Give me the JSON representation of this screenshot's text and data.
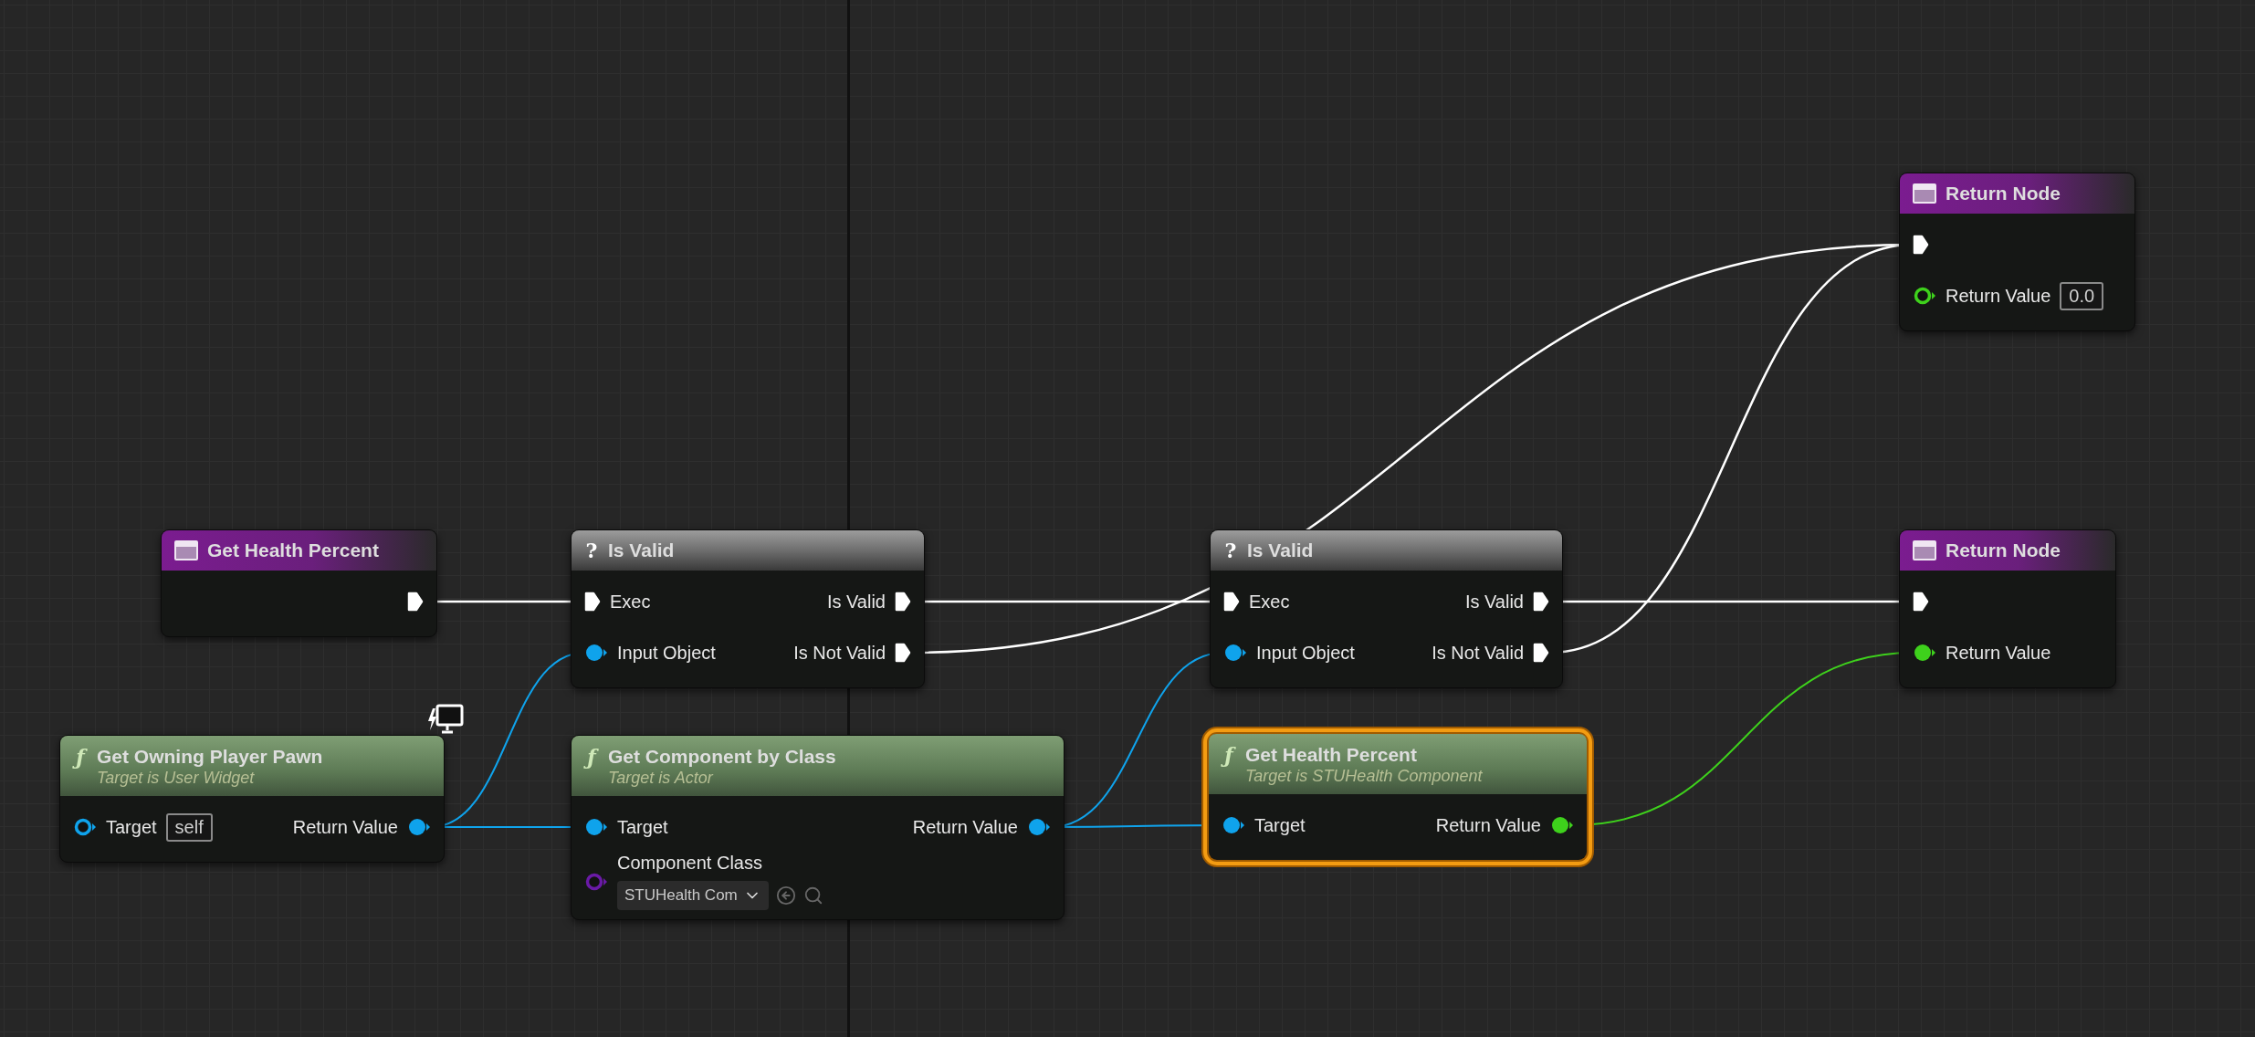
{
  "nodes": [
    {
      "kind": "entry",
      "title": "Return Node",
      "selected": false,
      "inputs": [
        {
          "kind": "exec",
          "connected": true
        },
        {
          "kind": "float",
          "label": "Return Value",
          "connected": false,
          "value": "0.0"
        }
      ]
    },
    {
      "kind": "entry",
      "title": "Get Health Percent",
      "selected": false,
      "outputs": [
        {
          "kind": "exec",
          "connected": true
        }
      ]
    },
    {
      "kind": "macro",
      "glyph": "?",
      "title": "Is Valid",
      "selected": false,
      "inputs": [
        {
          "kind": "exec",
          "label": "Exec",
          "connected": true
        },
        {
          "kind": "object",
          "label": "Input Object",
          "connected": true
        }
      ],
      "outputs": [
        {
          "kind": "exec",
          "label": "Is Valid",
          "connected": true
        },
        {
          "kind": "exec",
          "label": "Is Not Valid",
          "connected": true
        }
      ]
    },
    {
      "kind": "macro",
      "glyph": "?",
      "title": "Is Valid",
      "selected": false,
      "inputs": [
        {
          "kind": "exec",
          "label": "Exec",
          "connected": true
        },
        {
          "kind": "object",
          "label": "Input Object",
          "connected": true
        }
      ],
      "outputs": [
        {
          "kind": "exec",
          "label": "Is Valid",
          "connected": true
        },
        {
          "kind": "exec",
          "label": "Is Not Valid",
          "connected": true
        }
      ]
    },
    {
      "kind": "entry",
      "title": "Return Node",
      "selected": false,
      "inputs": [
        {
          "kind": "exec",
          "connected": true
        },
        {
          "kind": "float",
          "label": "Return Value",
          "connected": true
        }
      ]
    },
    {
      "kind": "function",
      "glyph": "ƒ",
      "title": "Get Owning Player Pawn",
      "subtitle": "Target is User Widget",
      "client_only": true,
      "selected": false,
      "inputs": [
        {
          "kind": "object",
          "label": "Target",
          "connected": false,
          "value": "self"
        }
      ],
      "outputs": [
        {
          "kind": "object",
          "label": "Return Value",
          "connected": true
        }
      ]
    },
    {
      "kind": "function",
      "glyph": "ƒ",
      "title": "Get Component by Class",
      "subtitle": "Target is Actor",
      "selected": false,
      "inputs": [
        {
          "kind": "object",
          "label": "Target",
          "connected": true
        },
        {
          "kind": "class",
          "label": "Component Class",
          "connected": false,
          "dropdown": "STUHealth Com"
        }
      ],
      "outputs": [
        {
          "kind": "object",
          "label": "Return Value",
          "connected": true
        }
      ]
    },
    {
      "kind": "function",
      "glyph": "ƒ",
      "title": "Get Health Percent",
      "subtitle": "Target is STUHealth Component",
      "selected": true,
      "inputs": [
        {
          "kind": "object",
          "label": "Target",
          "connected": true
        }
      ],
      "outputs": [
        {
          "kind": "float",
          "label": "Return Value",
          "connected": true
        }
      ]
    }
  ]
}
